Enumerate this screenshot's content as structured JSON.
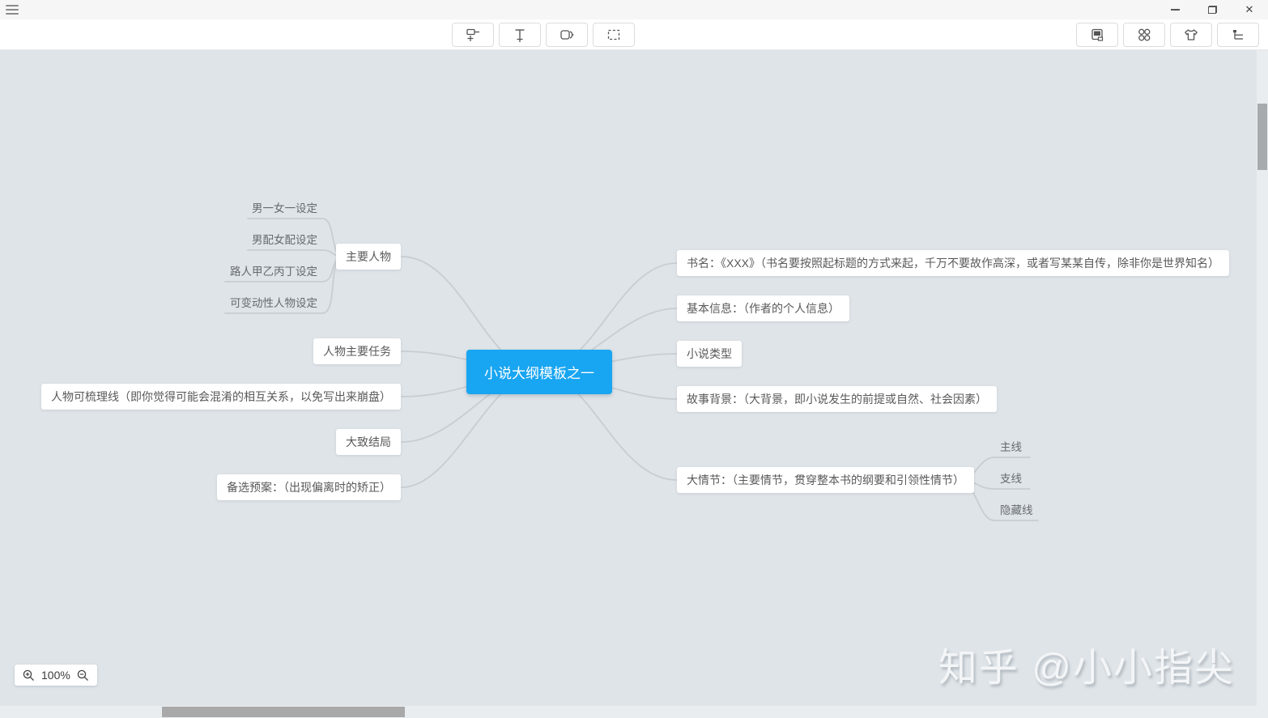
{
  "titlebar": {
    "menu_icon": "hamburger-icon",
    "window_controls": [
      {
        "name": "minimize"
      },
      {
        "name": "restore"
      },
      {
        "name": "close"
      }
    ]
  },
  "toolbar": {
    "left_group": [
      {
        "name": "insert-node",
        "icon": "node-plus-icon"
      },
      {
        "name": "insert-text",
        "icon": "text-plus-icon"
      },
      {
        "name": "summary",
        "icon": "summary-brace-icon"
      },
      {
        "name": "select-area",
        "icon": "dashed-box-icon"
      }
    ],
    "right_group": [
      {
        "name": "style-card",
        "icon": "card-icon"
      },
      {
        "name": "structure",
        "icon": "four-shapes-icon"
      },
      {
        "name": "theme",
        "icon": "tshirt-icon"
      },
      {
        "name": "outline",
        "icon": "outline-list-icon"
      }
    ]
  },
  "zoom_control": {
    "zoom_in_icon": "magnifier-plus-icon",
    "level": "100%",
    "zoom_out_icon": "magnifier-minus-icon"
  },
  "watermark": "知乎 @小小指尖",
  "mindmap": {
    "root": {
      "label": "小说大纲模板之一"
    },
    "left": [
      {
        "label": "主要人物",
        "children": [
          "男一女一设定",
          "男配女配设定",
          "路人甲乙丙丁设定",
          "可变动性人物设定"
        ]
      },
      {
        "label": "人物主要任务"
      },
      {
        "label": "人物可梳理线（即你觉得可能会混淆的相互关系，以免写出来崩盘）"
      },
      {
        "label": "大致结局"
      },
      {
        "label": "备选预案：（出现偏离时的矫正）"
      }
    ],
    "right": [
      {
        "label": "书名：《XXX》（书名要按照起标题的方式来起，千万不要故作高深，或者写某某自传，除非你是世界知名）"
      },
      {
        "label": "基本信息：（作者的个人信息）"
      },
      {
        "label": "小说类型"
      },
      {
        "label": "故事背景：（大背景，即小说发生的前提或自然、社会因素）"
      },
      {
        "label": "大情节：（主要情节，贯穿整本书的纲要和引领性情节）",
        "children": [
          "主线",
          "支线",
          "隐藏线"
        ]
      }
    ]
  },
  "colors": {
    "root_node_bg": "#18a5f1",
    "canvas_bg": "#dfe4e8",
    "connector": "#c8cdd2",
    "node_text": "#595959"
  }
}
